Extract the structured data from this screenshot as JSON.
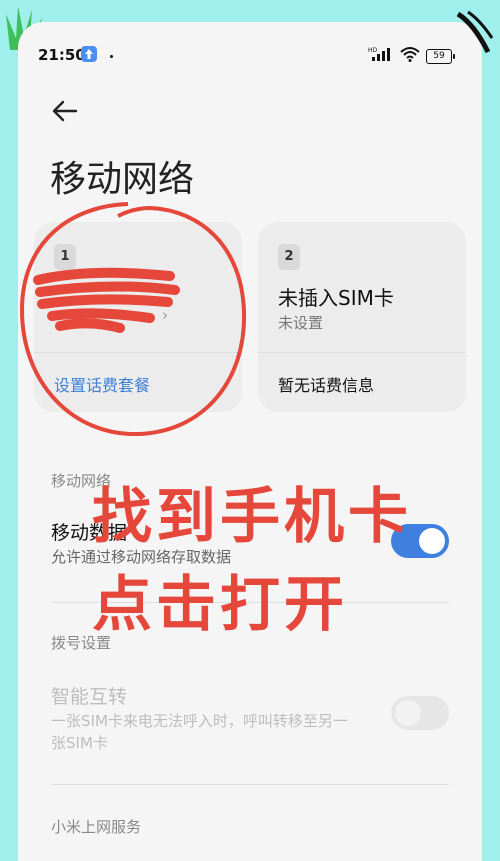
{
  "status_bar": {
    "time": "21:50",
    "network_label": "HD",
    "battery": "59"
  },
  "page": {
    "title": "移动网络"
  },
  "sim_cards": [
    {
      "index": "1",
      "name": "",
      "status": "",
      "action": "设置话费套餐"
    },
    {
      "index": "2",
      "name": "未插入SIM卡",
      "status": "未设置",
      "action": "暂无话费信息"
    }
  ],
  "mobile_network": {
    "section_label": "移动网络",
    "mobile_data_title": "移动数据",
    "mobile_data_desc": "允许通过移动网络存取数据",
    "mobile_data_enabled": true
  },
  "dial_settings": {
    "section_label": "拨号设置",
    "smart_forward_title": "智能互转",
    "smart_forward_desc_line1": "一张SIM卡来电无法呼入时，呼叫转移至另一",
    "smart_forward_desc_line2": "张SIM卡",
    "smart_forward_enabled": false
  },
  "xiaomi_service": {
    "section_label": "小米上网服务"
  },
  "annotations": {
    "line1": "找到手机卡",
    "line2": "点击打开",
    "color": "#e5473a"
  },
  "colors": {
    "accent": "#3e7fe0",
    "background": "#9ff0ec"
  }
}
